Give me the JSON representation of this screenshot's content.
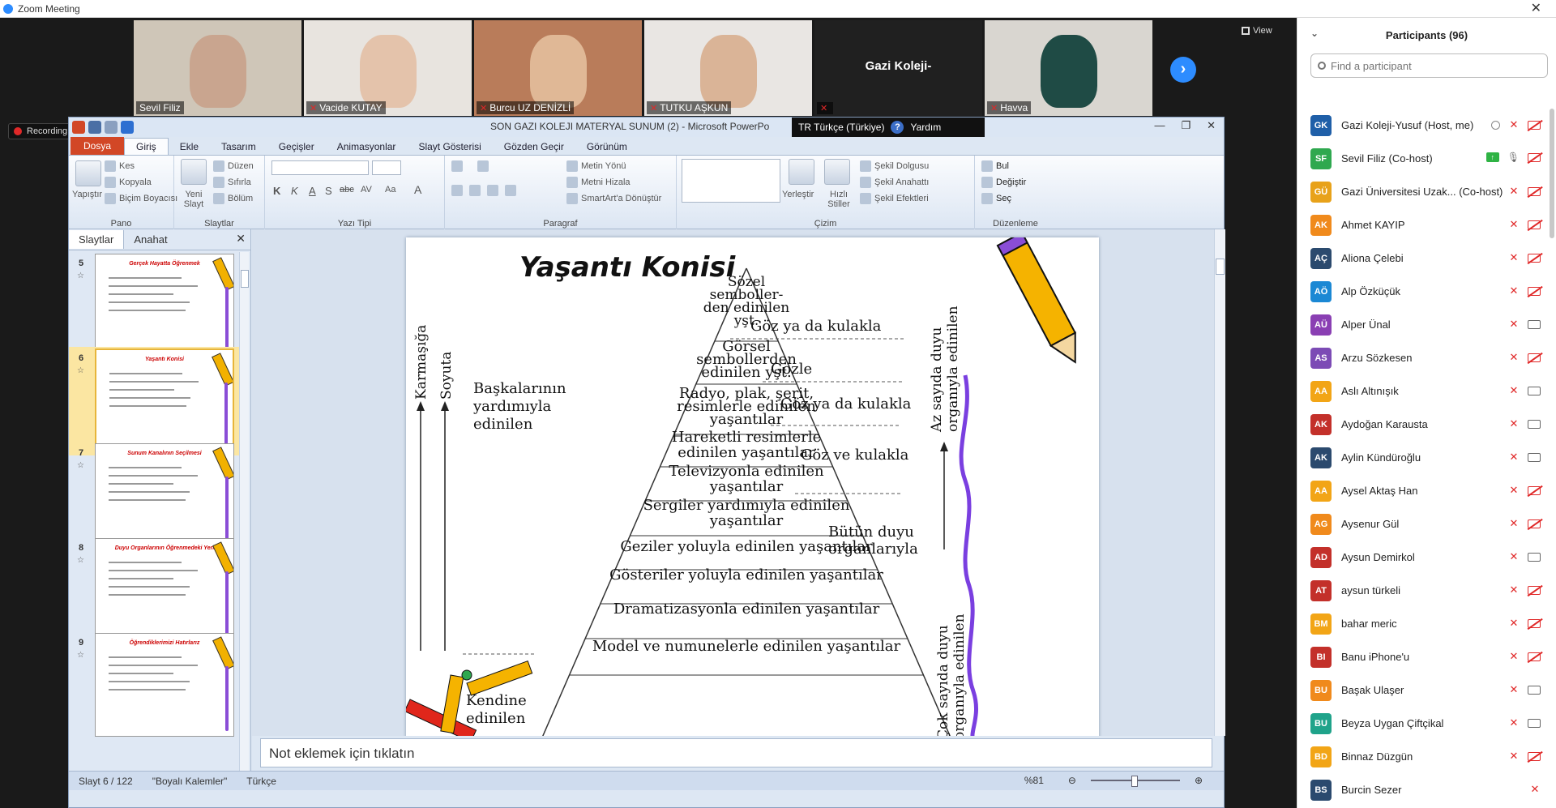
{
  "zoom": {
    "window_title": "Zoom Meeting",
    "close_glyph": "✕",
    "view_label": "View",
    "recording_label": "Recording...",
    "next_glyph": "›"
  },
  "gallery": [
    {
      "name": "Sevil Filiz",
      "muted": false,
      "bg": "#cfc6b8",
      "face": "#c9a58f"
    },
    {
      "name": "Vacide KUTAY",
      "muted": true,
      "bg": "#e8e4df",
      "face": "#e4c3ab"
    },
    {
      "name": "Burcu UZ DENİZLİ",
      "muted": true,
      "bg": "#b97c5a",
      "face": "#e0b896"
    },
    {
      "name": "TUTKU AŞKUN",
      "muted": true,
      "bg": "#e9e6e3",
      "face": "#dab497"
    },
    {
      "name": "",
      "label": "Gazi Koleji-",
      "muted": true,
      "bg": "#202020"
    },
    {
      "name": "Havva",
      "muted": true,
      "bg": "#d9d6d0",
      "face": "#1f4b45"
    }
  ],
  "ppt": {
    "doc_title": "SON GAZI KOLEJI MATERYAL SUNUM (2)  -  Microsoft PowerPo",
    "lang": "TR Türkçe (Türkiye)",
    "help": "Yardım",
    "help_glyph": "?",
    "win_minimize": "—",
    "win_restore": "❐",
    "win_close": "✕",
    "tabs": [
      "Dosya",
      "Giriş",
      "Ekle",
      "Tasarım",
      "Geçişler",
      "Animasyonlar",
      "Slayt Gösterisi",
      "Gözden Geçir",
      "Görünüm"
    ],
    "ribbon": {
      "pano": {
        "name": "Pano",
        "paste": "Yapıştır",
        "cut": "Kes",
        "copy": "Kopyala",
        "format_painter": "Biçim Boyacısı"
      },
      "slaytlar": {
        "name": "Slaytlar",
        "new_slide": "Yeni Slayt",
        "layout": "Düzen",
        "reset": "Sıfırla",
        "section": "Bölüm"
      },
      "yazi_tipi": {
        "name": "Yazı Tipi",
        "bold": "K",
        "italic": "K",
        "underline": "A",
        "shadow": "S",
        "strike": "abc",
        "spacing": "AV",
        "case": "Aa",
        "color": "A"
      },
      "paragraf": {
        "name": "Paragraf",
        "text_dir": "Metin Yönü",
        "align_text": "Metni Hizala",
        "smartart": "SmartArt'a Dönüştür"
      },
      "cizim": {
        "name": "Çizim",
        "arrange": "Yerleştir",
        "quick_styles": "Hızlı Stiller",
        "shape_fill": "Şekil Dolgusu",
        "shape_outline": "Şekil Anahattı",
        "shape_effects": "Şekil Efektleri"
      },
      "duzenleme": {
        "name": "Düzenleme",
        "find": "Bul",
        "replace": "Değiştir",
        "select": "Seç"
      }
    },
    "pane_tabs": [
      "Slaytlar",
      "Anahat"
    ],
    "pane_close": "✕",
    "thumbnails": [
      {
        "num": "5",
        "title": "Gerçek Hayatta Öğrenmek"
      },
      {
        "num": "6",
        "title": "Yaşantı Konisi"
      },
      {
        "num": "7",
        "title": "Sunum Kanalının Seçilmesi"
      },
      {
        "num": "8",
        "title": "Duyu Organlarının Öğrenmedeki Yeri"
      },
      {
        "num": "9",
        "title": "Öğrendiklerimizi Hatırlarız"
      }
    ],
    "notes_placeholder": "Not eklemek için tıklatın",
    "status": {
      "slide": "Slayt 6 / 122",
      "theme": "\"Boyalı Kalemler\"",
      "language": "Türkçe",
      "zoom": "%81"
    }
  },
  "slide": {
    "title": "Yaşantı Konisi",
    "cone_levels": [
      [
        "Sözel",
        "semboller-",
        "den edinilen",
        "yşt."
      ],
      [
        "Görsel",
        "sembollerden",
        "edinilen yşt."
      ],
      [
        "Radyo, plak, şerit,",
        "resimlerle edinilen",
        "yaşantılar"
      ],
      [
        "Hareketli resimlerle",
        "edinilen yaşantılar"
      ],
      [
        "Televizyonla edinilen",
        "yaşantılar"
      ],
      [
        "Sergiler yardımıyla edinilen",
        "yaşantılar"
      ],
      [
        "Geziler yoluyla edinilen yaşantılar"
      ],
      [
        "Gösteriler yoluyla edinilen yaşantılar"
      ],
      [
        "Dramatizasyonla edinilen yaşantılar"
      ],
      [
        "Model ve numunelerle edinilen yaşantılar"
      ]
    ],
    "right_labels": [
      "Göz ya da kulakla",
      "Gözle",
      "Göz ya da kulakla",
      "Göz ve kulakla",
      "Bütün duyu",
      "organlarıyla"
    ],
    "left_labels": [
      "Başkalarının",
      "yardımıyla",
      "edinilen"
    ],
    "vertical_left": [
      "Karmaşığa",
      "Soyuta"
    ],
    "vertical_right_top": [
      "Az sayıda duyu",
      "organıyla edinilen"
    ],
    "vertical_right_bottom": [
      "Çok sayıda duyu",
      "organıyla edinilen"
    ],
    "bottom_left_partial": [
      "Kendine",
      "edinilen"
    ]
  },
  "participants": {
    "header": "Participants (96)",
    "search_placeholder": "Find a participant",
    "collapse_glyph": "⌄",
    "list": [
      {
        "initials": "GK",
        "name": "Gazi Koleji-Yusuf (Host, me)",
        "color": "#1f5fa8",
        "extra": "rec"
      },
      {
        "initials": "SF",
        "name": "Sevil Filiz (Co-host)",
        "color": "#2fa84f",
        "extra": "share",
        "mic": "on"
      },
      {
        "initials": "GÜ",
        "name": "Gazi Üniversitesi Uzak...  (Co-host)",
        "color": "#e8a21a"
      },
      {
        "initials": "AK",
        "name": "Ahmet KAYIP",
        "color": "#f08a1c"
      },
      {
        "initials": "AÇ",
        "name": "Aliona Çelebi",
        "color": "#2b4a6e"
      },
      {
        "initials": "AÖ",
        "name": "Alp Özküçük",
        "color": "#1b88d4"
      },
      {
        "initials": "AÜ",
        "name": "Alper Ünal",
        "color": "#8a3fb3",
        "cam": "on"
      },
      {
        "initials": "AS",
        "name": "Arzu Sözkesen",
        "color": "#7c4bb5"
      },
      {
        "initials": "AA",
        "name": "Aslı Altınışık",
        "color": "#f2a516",
        "cam": "on"
      },
      {
        "initials": "AK",
        "name": "Aydoğan Karausta",
        "color": "#c3302a",
        "cam": "on"
      },
      {
        "initials": "AK",
        "name": "Aylin Kündüroğlu",
        "color": "#2b4a6e",
        "cam": "on"
      },
      {
        "initials": "AA",
        "name": "Aysel Aktaş Han",
        "color": "#f2a516"
      },
      {
        "initials": "AG",
        "name": "Aysenur Gül",
        "color": "#f08a1c"
      },
      {
        "initials": "AD",
        "name": "Aysun Demirkol",
        "color": "#c3302a",
        "cam": "on"
      },
      {
        "initials": "AT",
        "name": "aysun türkeli",
        "color": "#c3302a"
      },
      {
        "initials": "BM",
        "name": "bahar meric",
        "color": "#f2a516"
      },
      {
        "initials": "BI",
        "name": "Banu iPhone'u",
        "color": "#c3302a"
      },
      {
        "initials": "BU",
        "name": "Başak Ulaşer",
        "color": "#f08a1c",
        "cam": "on"
      },
      {
        "initials": "BU",
        "name": "Beyza Uygan Çiftçikal",
        "color": "#1fa38a",
        "cam": "on"
      },
      {
        "initials": "BD",
        "name": "Binnaz Düzgün",
        "color": "#f2a516"
      },
      {
        "initials": "BS",
        "name": "Burcin Sezer",
        "color": "#2b4a6e",
        "cam": "none"
      }
    ]
  }
}
